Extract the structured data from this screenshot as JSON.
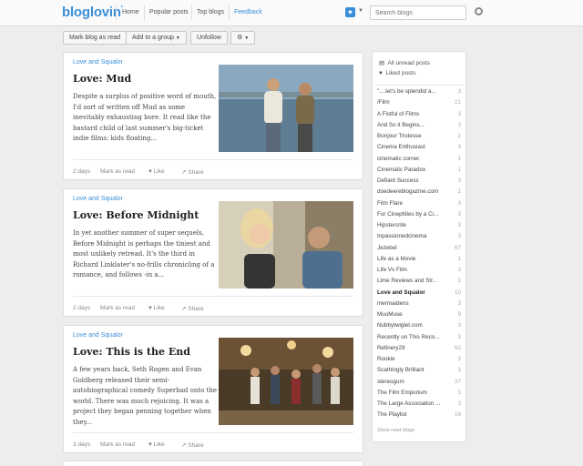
{
  "header": {
    "logo": "bloglovin",
    "logo_mark": "'",
    "nav": [
      "Home",
      "Popular posts",
      "Top blogs",
      "Feedback"
    ],
    "search_placeholder": "Search blogs"
  },
  "toolbar": {
    "mark_read": "Mark blog as read",
    "add_group": "Add to a group",
    "unfollow": "Unfollow"
  },
  "posts": [
    {
      "blog": "Love and Squalor",
      "title": "Love: Mud",
      "excerpt": "Despite a surplus of positive word of mouth, I'd sort of written off Mud as some inevitably exhausting bore. It read like the bastard child of last summer's big-ticket indie films: kids floating...",
      "date": "2 days",
      "mark_read": "Mark as read",
      "like": "Like",
      "share": "Share"
    },
    {
      "blog": "Love and Squalor",
      "title": "Love: Before Midnight",
      "excerpt": "In yet another summer of super sequels, Before Midnight is perhaps the tiniest and most unlikely retread. It's the third in Richard Linklater's no-frills chronicling of a romance, and follows -in a...",
      "date": "2 days",
      "mark_read": "Mark as read",
      "like": "Like",
      "share": "Share"
    },
    {
      "blog": "Love and Squalor",
      "title": "Love: This is the End",
      "excerpt": "A few years back, Seth Rogen and Evan Goldberg released their semi-autobiographical comedy Superbad onto the world. There was much rejoicing. It was a project they began penning together when they...",
      "date": "3 days",
      "mark_read": "Mark as read",
      "like": "Like",
      "share": "Share"
    }
  ],
  "sidebar": {
    "all_unread": "All unread posts",
    "liked": "Liked posts",
    "blogs": [
      {
        "name": "\"....let's be splendid a...",
        "count": "3"
      },
      {
        "name": "/Film",
        "count": "21"
      },
      {
        "name": "A Fistful of Films",
        "count": "3"
      },
      {
        "name": "And So it Begins...",
        "count": "3"
      },
      {
        "name": "Bonjour Tristesse",
        "count": "1"
      },
      {
        "name": "Cinema Enthusiast",
        "count": "3"
      },
      {
        "name": "cinematic corner.",
        "count": "1"
      },
      {
        "name": "Cinematic Paradox",
        "count": "1"
      },
      {
        "name": "Defiant Success",
        "count": "3"
      },
      {
        "name": "doedeereblogazine.com",
        "count": "1"
      },
      {
        "name": "Film Flare",
        "count": "3"
      },
      {
        "name": "For Cinephiles by a Ci...",
        "count": "3"
      },
      {
        "name": "Hipstercrite",
        "count": "3"
      },
      {
        "name": "Inpassionedcinema",
        "count": "3"
      },
      {
        "name": "Jezebel",
        "count": "67"
      },
      {
        "name": "Life as a Movie",
        "count": "1"
      },
      {
        "name": "Life Vs Film",
        "count": "3"
      },
      {
        "name": "Lime Reviews and Str...",
        "count": "3"
      },
      {
        "name": "Love and Squalor",
        "count": "10"
      },
      {
        "name": "mermaidens",
        "count": "3"
      },
      {
        "name": "MuuMuse",
        "count": "9"
      },
      {
        "name": "Nubbytwiglet.com",
        "count": "3"
      },
      {
        "name": "Recently on This Reco...",
        "count": "3"
      },
      {
        "name": "Refinery29",
        "count": "62"
      },
      {
        "name": "Rookie",
        "count": "3"
      },
      {
        "name": "Scathingly Brilliant",
        "count": "3"
      },
      {
        "name": "stereogum",
        "count": "37"
      },
      {
        "name": "The Film Emporium",
        "count": "3"
      },
      {
        "name": "The Large Association ...",
        "count": "3"
      },
      {
        "name": "The Playlist",
        "count": "16"
      }
    ],
    "show_read": "Show read blogs"
  }
}
